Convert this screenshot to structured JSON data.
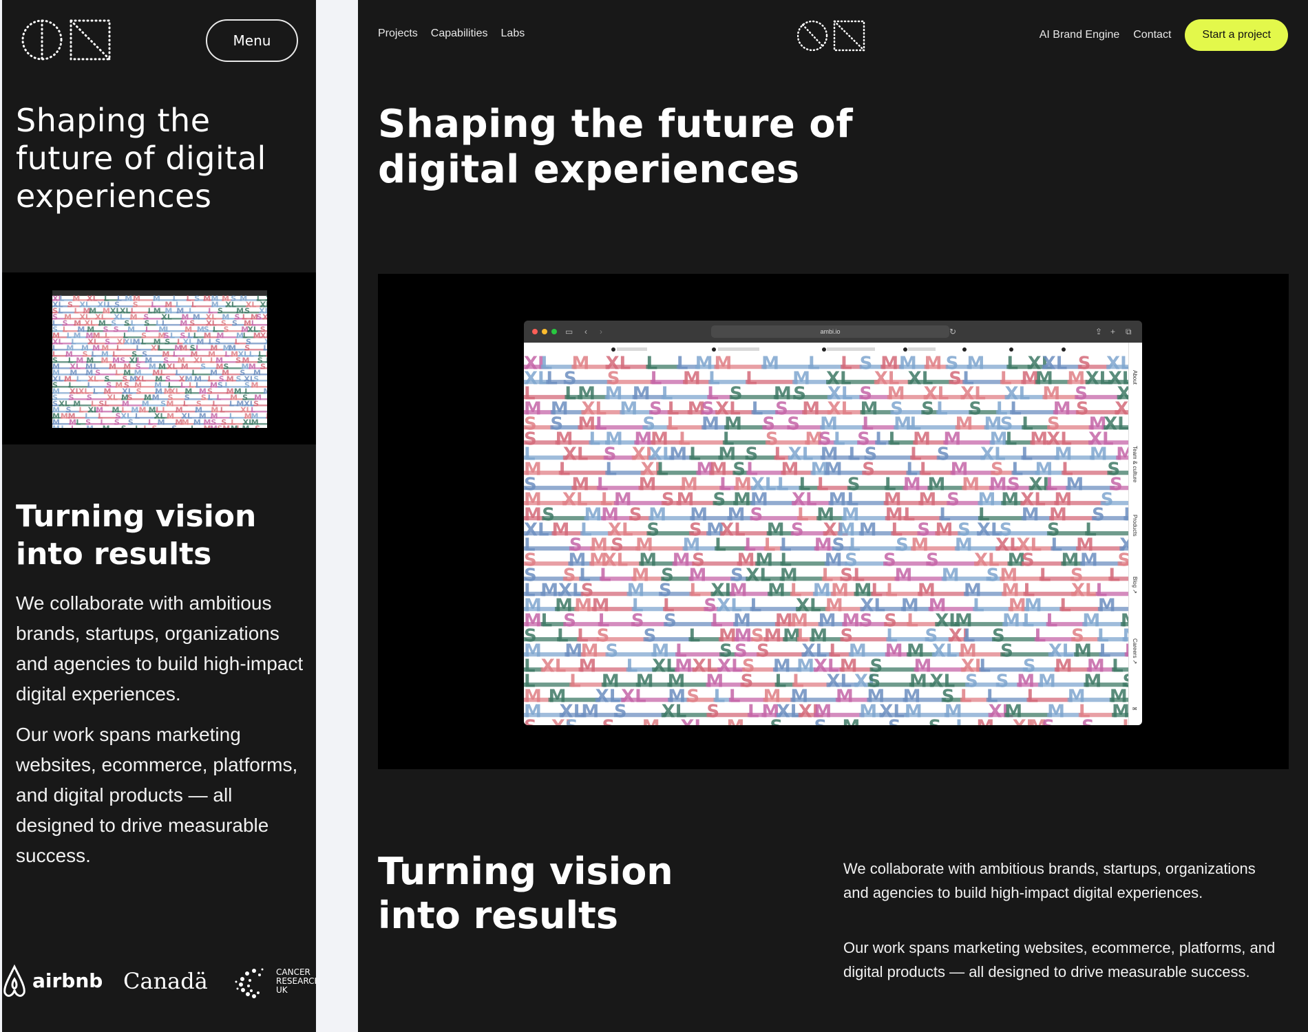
{
  "mobile": {
    "menu_label": "Menu",
    "hero_title": "Shaping the future of digital experiences",
    "section_title": "Turning vision into results",
    "paragraph_1": "We collaborate with ambitious brands, startups, organizations and agencies to build high-impact digital experiences.",
    "paragraph_2": "Our work spans marketing websites, ecommerce, platforms, and digital products — all designed to drive measurable success.",
    "client_logos": [
      {
        "name": "airbnb",
        "icon": "airbnb-logo"
      },
      {
        "name": "Canadä",
        "icon": "canada-wordmark"
      },
      {
        "name": "CANCER RESEARCH UK",
        "icon": "cancer-research-uk-logo"
      }
    ]
  },
  "desktop": {
    "nav_left": [
      "Projects",
      "Capabilities",
      "Labs"
    ],
    "nav_right": [
      "AI Brand Engine",
      "Contact"
    ],
    "cta_label": "Start a project",
    "hero_title": "Shaping the future of digital experiences",
    "browser_url": "ambi.io",
    "browser_side_labels": [
      "About",
      "Team & culture",
      "Products",
      "Blog ↗",
      "Careers ↗"
    ],
    "section_title": "Turning vision into results",
    "paragraph_1": "We collaborate with ambitious brands, startups, organizations and agencies to build high-impact digital experiences.",
    "paragraph_2": "Our work spans marketing websites, ecommerce, platforms, and digital products — all designed to drive measurable success."
  },
  "colors": {
    "background": "#181818",
    "cta": "#e3f84b",
    "gutter": "#f2f3f7",
    "pattern": [
      "#3f7a66",
      "#d46a7a",
      "#7fa6cf",
      "#c566a8",
      "#6d8fc0",
      "#e07f86"
    ]
  }
}
